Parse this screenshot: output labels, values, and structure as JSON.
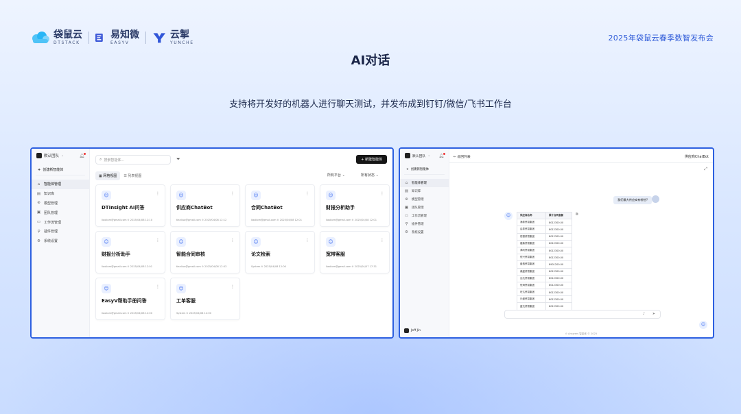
{
  "header": {
    "logos": [
      {
        "cn": "袋鼠云",
        "en": "DTSTACK"
      },
      {
        "cn": "易知微",
        "en": "EASYV"
      },
      {
        "cn": "云掣",
        "en": "YUNCHE"
      }
    ],
    "event_title": "2025年袋鼠云春季数智发布会",
    "page_title": "AI对话",
    "subtitle": "支持将开发好的机器人进行聊天测试，并发布成到钉钉/微信/飞书工作台"
  },
  "left_app": {
    "team": "默认团队",
    "new_agent": "创建新智能体",
    "sidebar": [
      {
        "label": "智能体管理",
        "icon": "robot-icon",
        "active": true
      },
      {
        "label": "知识库",
        "icon": "database-icon"
      },
      {
        "label": "模型管理",
        "icon": "model-icon"
      },
      {
        "label": "团队管理",
        "icon": "team-icon"
      },
      {
        "label": "工作流管理",
        "icon": "workflow-icon"
      },
      {
        "label": "插件管理",
        "icon": "plugin-icon"
      },
      {
        "label": "系统设置",
        "icon": "gear-icon"
      }
    ],
    "search_placeholder": "搜索智能体...",
    "new_button": "新建智能体",
    "views": [
      "网格视图",
      "列表视图"
    ],
    "filter_platform": "所有平台",
    "filter_status": "所有状态",
    "cards": [
      {
        "name": "DTInsight AI问答",
        "meta": "liaoliom@gmail.com ⊙ 2025/04/08 12:10"
      },
      {
        "name": "供应商ChatBot",
        "meta": "tianliuo@gmail.com ⊙ 2025/04/08 12:12"
      },
      {
        "name": "合同ChatBot",
        "meta": "liaoliom@gmail.com ⊙ 2025/04/08 12:01"
      },
      {
        "name": "财报分析助手",
        "meta": "liaoliom@gmail.com ⊙ 2025/04/08 12:01"
      },
      {
        "name": "财报分析助手",
        "meta": "liaoliom@gmail.com ⊙ 2025/04/08 12:01"
      },
      {
        "name": "智能合同审核",
        "meta": "tianliuo@gmail.com ⊙ 2025/04/08 12:03"
      },
      {
        "name": "论文检索",
        "meta": "System ⊙ 2025/04/08 12:00"
      },
      {
        "name": "宽带客服",
        "meta": "liaoliom@gmail.com ⊙ 2025/04/07 17:31"
      },
      {
        "name": "EasyV帮助手册问答",
        "meta": "liaoliom@gmail.com ⊙ 2025/04/08 12:00"
      },
      {
        "name": "工单客服",
        "meta": "System ⊙ 2025/04/08 12:00"
      }
    ]
  },
  "right_app": {
    "team": "默认团队",
    "new_agent": "创建新智能体",
    "sidebar": [
      {
        "label": "智能体管理",
        "icon": "robot-icon",
        "active": true
      },
      {
        "label": "知识库",
        "icon": "database-icon"
      },
      {
        "label": "模型管理",
        "icon": "model-icon"
      },
      {
        "label": "团队管理",
        "icon": "team-icon"
      },
      {
        "label": "工作流管理",
        "icon": "workflow-icon"
      },
      {
        "label": "插件管理",
        "icon": "plugin-icon"
      },
      {
        "label": "系统设置",
        "icon": "gear-icon"
      }
    ],
    "user": "Jeff Jin",
    "back": "← 返回列表",
    "bot_title": "供应商ChatBot",
    "user_message": "我们最大供应商有哪些?",
    "table": {
      "headers": [
        "供应商名称",
        "累计合同金额"
      ],
      "rows": [
        [
          "涌泰贸易集团",
          "8012300.00"
        ],
        [
          "启泰贸易集团",
          "8012300.00"
        ],
        [
          "恒德贸易集团",
          "8012300.00"
        ],
        [
          "嘉鼎贸易集团",
          "8012300.00"
        ],
        [
          "满利贸易集团",
          "8012300.00"
        ],
        [
          "恒兴贸易集团",
          "8012300.00"
        ],
        [
          "盛昌贸易集团",
          "8901200.00"
        ],
        [
          "鼎盛贸易集团",
          "8012300.00"
        ],
        [
          "远达贸易集团",
          "8012300.00"
        ],
        [
          "恒海贸易集团",
          "8012300.00"
        ],
        [
          "旺达贸易集团",
          "8012300.00"
        ],
        [
          "乐盛贸易集团",
          "8012300.00"
        ],
        [
          "盛达贸易集团",
          "8012300.00"
        ]
      ]
    },
    "footer": "⊙ Answers 智能体 © 2025"
  }
}
